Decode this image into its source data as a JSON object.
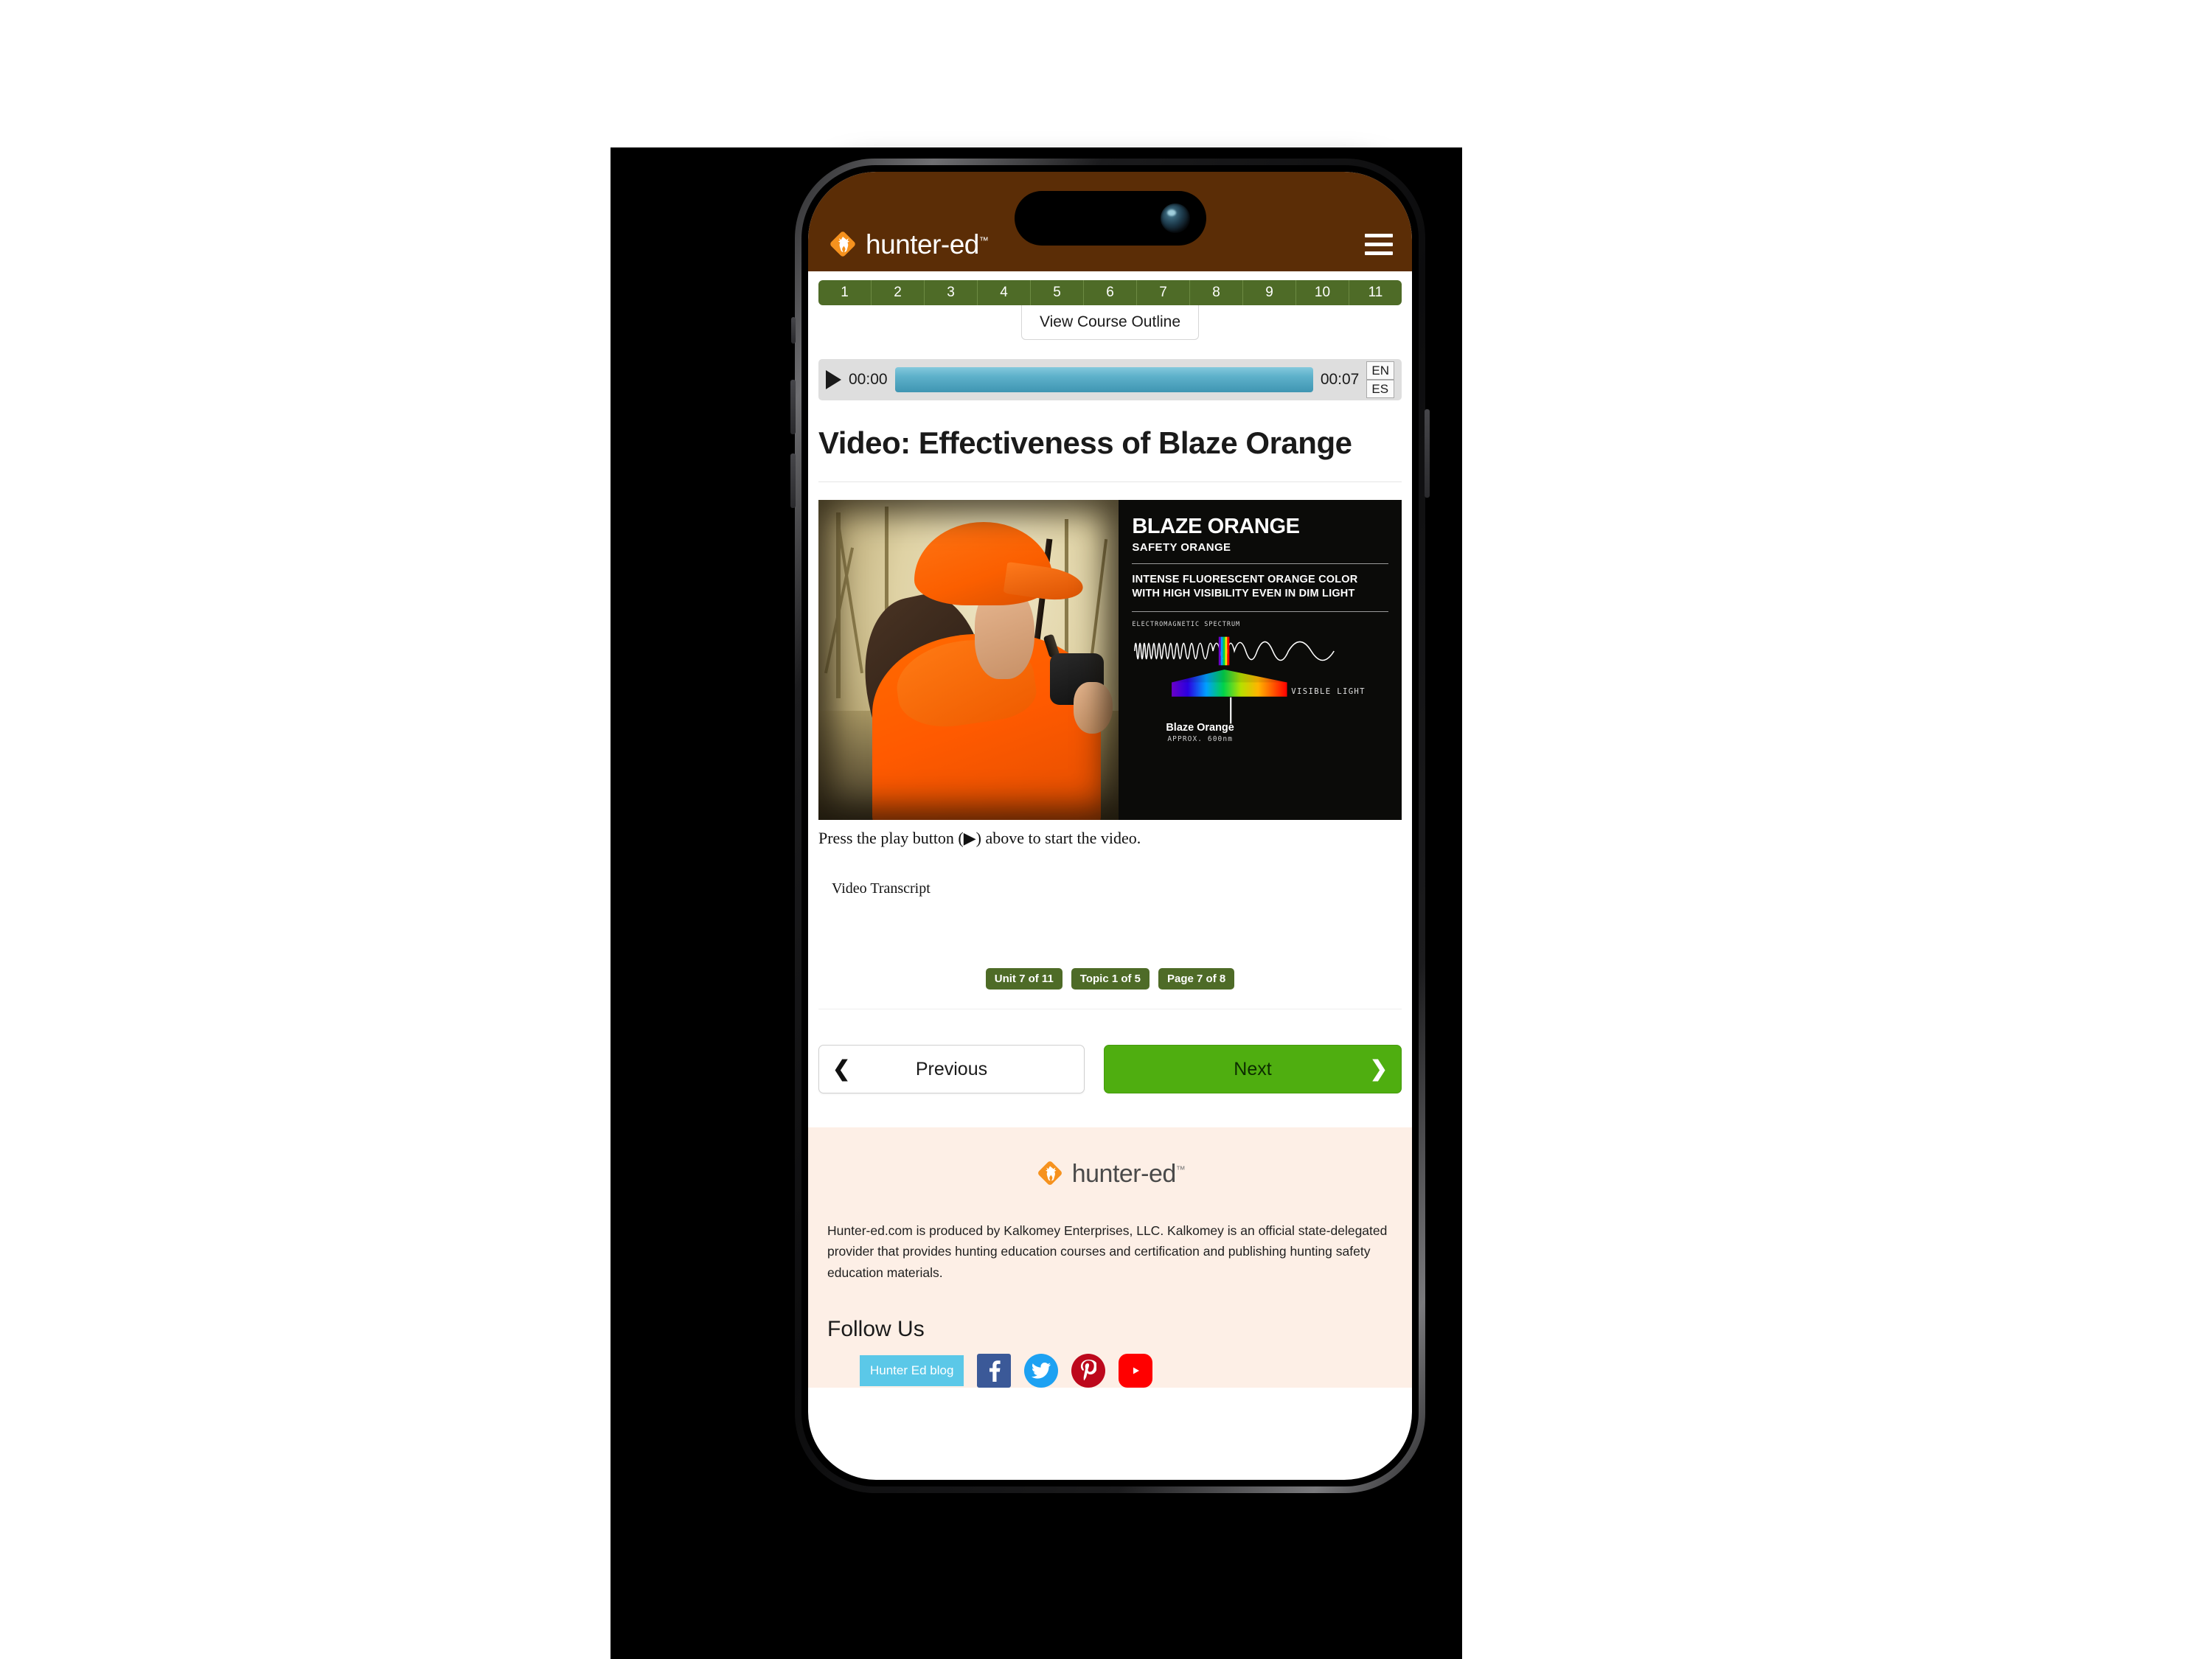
{
  "device": {
    "name": "iphone-mockup",
    "dynamic_island": "dynamic-island",
    "camera": "front-camera-icon"
  },
  "header": {
    "brand_name": "hunter-ed",
    "brand_tm": "™",
    "logo_icon": "deer-head-diamond-logo",
    "menu_icon": "hamburger-menu-icon",
    "bg_color": "#5b2d06"
  },
  "unit_nav": {
    "units": [
      "1",
      "2",
      "3",
      "4",
      "5",
      "6",
      "7",
      "8",
      "9",
      "10",
      "11"
    ],
    "active_unit": "7",
    "outline_button": "View Course Outline",
    "strip_color": "#4e6b27"
  },
  "audio_player": {
    "play_icon": "play-triangle-icon",
    "current_time": "00:00",
    "duration": "00:07",
    "lang_en": "EN",
    "lang_es": "ES",
    "track_color": "#5fb2cb"
  },
  "main": {
    "page_title": "Video: Effectiveness of Blaze Orange",
    "caption": "Press the play button (▶) above to start the video.",
    "transcript_label": "Video Transcript"
  },
  "video_thumb": {
    "alt": "hunter-in-blaze-orange-photo",
    "title": "BLAZE ORANGE",
    "subtitle": "SAFETY ORANGE",
    "body": "INTENSE FLUORESCENT ORANGE COLOR WITH HIGH VISIBILITY EVEN IN DIM LIGHT",
    "spectrum_label": "ELECTROMAGNETIC SPECTRUM",
    "visible_light_label": "VISIBLE LIGHT",
    "callout_title": "Blaze Orange",
    "callout_sub": "APPROX. 600nm"
  },
  "progress": {
    "unit": "Unit 7 of 11",
    "topic": "Topic 1 of 5",
    "page": "Page 7 of 8",
    "badge_color": "#4e6b27"
  },
  "navigation": {
    "previous": "Previous",
    "next": "Next",
    "prev_icon": "chevron-left-icon",
    "next_icon": "chevron-right-icon",
    "next_color": "#4fae10"
  },
  "footer": {
    "brand_name": "hunter-ed",
    "brand_tm": "™",
    "logo_icon": "deer-head-diamond-logo",
    "description": "Hunter-ed.com is produced by Kalkomey Enterprises, LLC. Kalkomey is an official state-delegated provider that provides hunting education courses and certification and publishing hunting safety education materials.",
    "follow_title": "Follow Us",
    "bg_color": "#fdefe6",
    "social": [
      {
        "name": "hunter-ed-blog",
        "label": "Hunter Ed blog",
        "color": "#5bc8e8"
      },
      {
        "name": "facebook-icon",
        "label": "",
        "color": "#3b5998"
      },
      {
        "name": "twitter-icon",
        "label": "",
        "color": "#1da1f2"
      },
      {
        "name": "pinterest-icon",
        "label": "",
        "color": "#bd081c"
      },
      {
        "name": "youtube-icon",
        "label": "",
        "color": "#ff0000"
      }
    ]
  }
}
